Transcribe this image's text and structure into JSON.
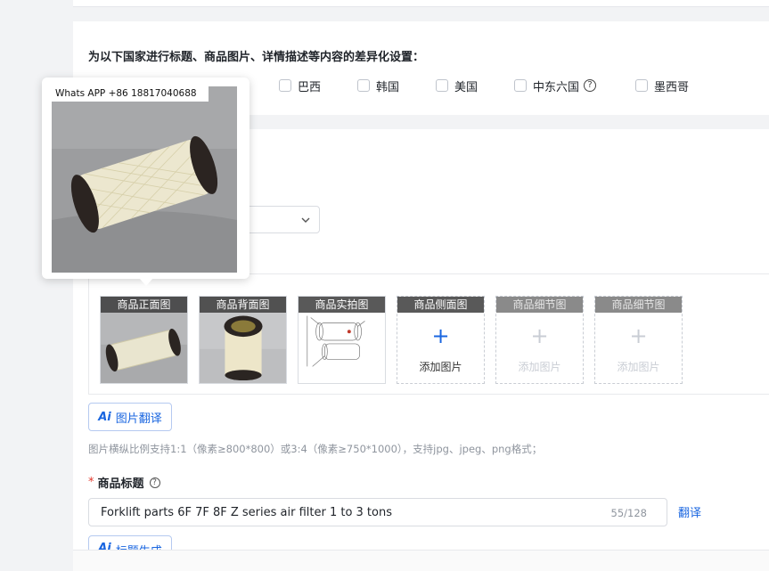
{
  "country_settings": {
    "title": "为以下国家进行标题、商品图片、详情描述等内容的差异化设置：",
    "countries": [
      {
        "label": "巴西",
        "checked": false
      },
      {
        "label": "韩国",
        "checked": false
      },
      {
        "label": "美国",
        "checked": false
      },
      {
        "label": "中东六国",
        "checked": false,
        "has_help": true
      },
      {
        "label": "墨西哥",
        "checked": false
      }
    ]
  },
  "image_slots": [
    {
      "label": "商品正面图",
      "state": "filled",
      "photo": "air-filter-side-view"
    },
    {
      "label": "商品背面图",
      "state": "filled",
      "photo": "air-filter-top-view"
    },
    {
      "label": "商品实拍图",
      "state": "filled",
      "photo": "air-filter-diagram"
    },
    {
      "label": "商品侧面图",
      "state": "empty",
      "add_label": "添加图片"
    },
    {
      "label": "商品细节图",
      "state": "disabled",
      "add_label": "添加图片"
    },
    {
      "label": "商品细节图",
      "state": "disabled",
      "add_label": "添加图片"
    }
  ],
  "image_translate_button": {
    "ai": "Ai",
    "label": "图片翻译"
  },
  "image_hint": "图片横纵比例支持1:1（像素≥800*800）或3:4（像素≥750*1000），支持jpg、jpeg、png格式；",
  "product_title": {
    "required_mark": "*",
    "label": "商品标题",
    "value": "Forklift parts 6F 7F 8F Z series air filter 1 to 3 tons",
    "count": "55/128",
    "translate_link": "翻译"
  },
  "title_generate_button": {
    "ai": "Ai",
    "label": "标题生成"
  },
  "popover": {
    "watermark": "Whats APP +86 18817040688",
    "photo": "air-filter-large-preview"
  },
  "colors": {
    "accent": "#1a66e0",
    "required": "#e2382b",
    "hint": "#8f959e",
    "border": "#d9dce1",
    "page_bg": "#f2f3f5"
  },
  "icons": {
    "help": "question-circle-icon",
    "select": "chevron-down-icon",
    "plus": "plus-icon"
  }
}
